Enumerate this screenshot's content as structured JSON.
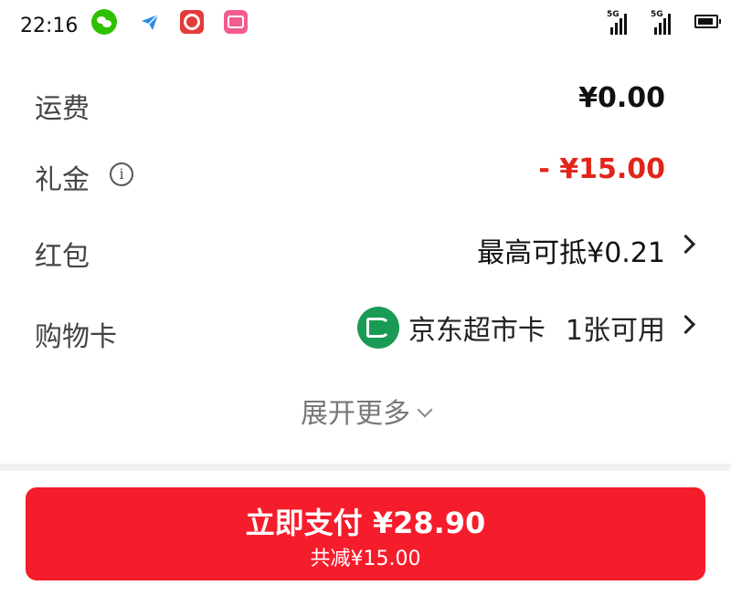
{
  "status": {
    "time": "22:16",
    "signal1": "5G",
    "signal2": "5G"
  },
  "rows": {
    "shipping": {
      "label": "运费",
      "value": "¥0.00"
    },
    "gift": {
      "label": "礼金",
      "value": "- ¥15.00",
      "info_icon": "info-icon"
    },
    "redpacket": {
      "label": "红包",
      "value": "最高可抵¥0.21"
    },
    "shopping_card": {
      "label": "购物卡",
      "card_name": "京东超市卡",
      "card_count": "1张可用"
    }
  },
  "expand": {
    "label": "展开更多"
  },
  "pay": {
    "main": "立即支付 ¥28.90",
    "sub": "共减¥15.00"
  },
  "colors": {
    "accent": "#f51d2b",
    "discount": "#e1251b",
    "card_icon": "#1a9b55"
  }
}
